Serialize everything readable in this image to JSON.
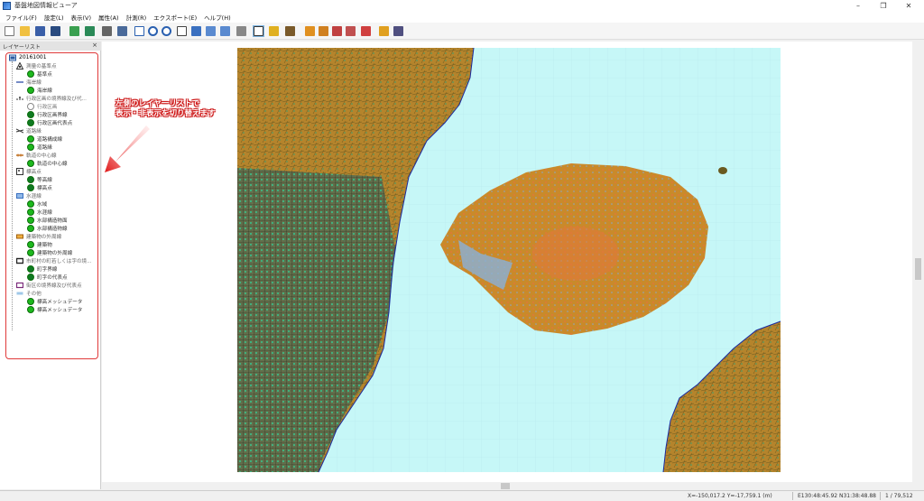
{
  "window": {
    "title": "基盤地図情報ビューア"
  },
  "menu": [
    "ファイル(F)",
    "設定(L)",
    "表示(V)",
    "属性(A)",
    "計測(R)",
    "エクスポート(E)",
    "ヘルプ(H)"
  ],
  "toolbar": {
    "icons": [
      "new-icon",
      "open-icon",
      "save-icon",
      "save-as-icon",
      "export-icon",
      "map-icon",
      "print-icon",
      "print-preview-icon",
      "fit-icon",
      "zoom-in-icon",
      "zoom-out-icon",
      "zoom-window-icon",
      "pan-icon",
      "back-icon",
      "forward-icon",
      "measure-icon",
      "select-icon",
      "layer-icon",
      "paint-icon",
      "flag-icon",
      "flag2-icon",
      "flag3-icon",
      "flag4-icon",
      "sheet-icon",
      "help-icon",
      "pointer-help-icon"
    ]
  },
  "layer_panel": {
    "title": "レイヤーリスト",
    "root": "20161001",
    "items": [
      {
        "label": "測量の基準点",
        "type": "parent"
      },
      {
        "label": "基準点",
        "type": "leaf"
      },
      {
        "label": "海岸線",
        "type": "parent"
      },
      {
        "label": "海岸線",
        "type": "leaf"
      },
      {
        "label": "行政区画の境界線及び代...",
        "type": "parent"
      },
      {
        "label": "行政区画",
        "type": "leaf"
      },
      {
        "label": "行政区画界線",
        "type": "leaf"
      },
      {
        "label": "行政区画代表点",
        "type": "leaf"
      },
      {
        "label": "道路縁",
        "type": "parent"
      },
      {
        "label": "道路構成線",
        "type": "leaf"
      },
      {
        "label": "道路縁",
        "type": "leaf"
      },
      {
        "label": "軌道の中心線",
        "type": "parent"
      },
      {
        "label": "軌道の中心線",
        "type": "leaf"
      },
      {
        "label": "標高点",
        "type": "parent"
      },
      {
        "label": "等高線",
        "type": "leaf"
      },
      {
        "label": "標高点",
        "type": "leaf"
      },
      {
        "label": "水涯線",
        "type": "parent"
      },
      {
        "label": "水域",
        "type": "leaf"
      },
      {
        "label": "水涯線",
        "type": "leaf"
      },
      {
        "label": "水部構造物面",
        "type": "leaf"
      },
      {
        "label": "水部構造物線",
        "type": "leaf"
      },
      {
        "label": "建築物の外周線",
        "type": "parent"
      },
      {
        "label": "建築物",
        "type": "leaf"
      },
      {
        "label": "建築物の外周線",
        "type": "leaf"
      },
      {
        "label": "市町村の町若しくは字の境...",
        "type": "parent"
      },
      {
        "label": "町字界線",
        "type": "leaf"
      },
      {
        "label": "町字の代表点",
        "type": "leaf"
      },
      {
        "label": "街区の境界線及び代表点",
        "type": "parent"
      },
      {
        "label": "その他",
        "type": "parent"
      },
      {
        "label": "標高メッシュデータ",
        "type": "leaf"
      },
      {
        "label": "標高メッシュデータ",
        "type": "leaf"
      }
    ]
  },
  "annotation": {
    "line1": "左側のレイヤーリストで",
    "line2": "表示・非表示を切り替えます"
  },
  "status": {
    "xy": "X=-150,017.2 Y=-17,759.1 (m)",
    "latlon": "E130:48:45.92 N31:38:48.88",
    "scale": "1 / 79,512"
  },
  "colors": {
    "sea": "#c6f7f7",
    "land": "#b8862a",
    "accent": "#e03a3a"
  }
}
